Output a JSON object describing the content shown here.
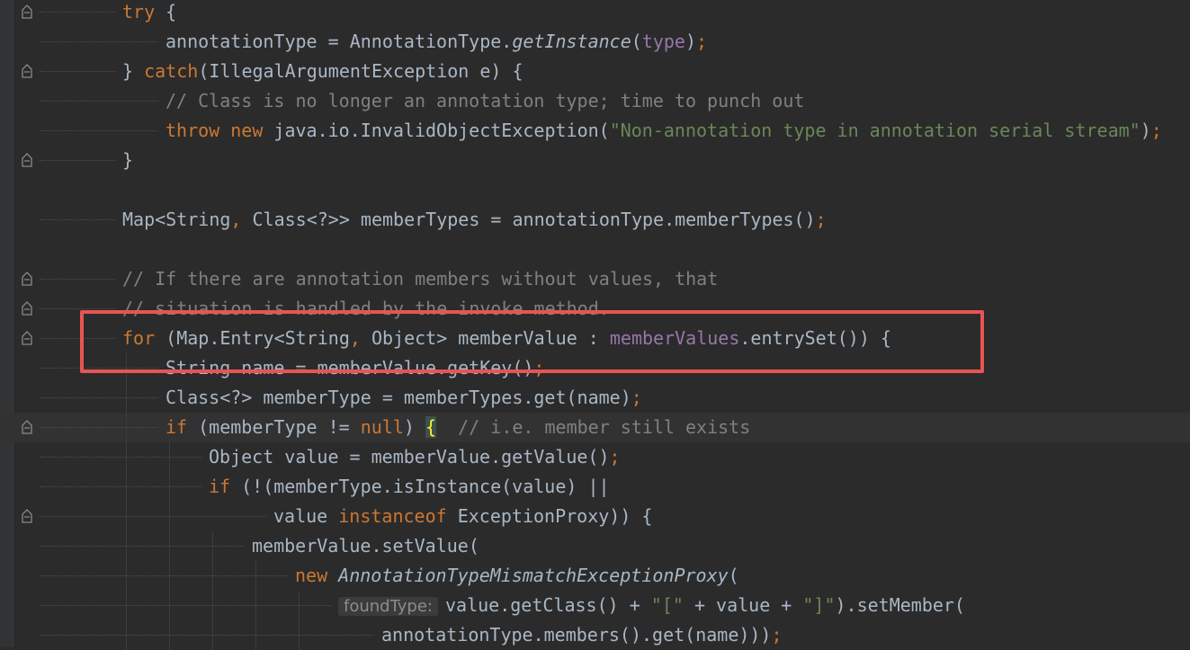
{
  "editor": {
    "lines": [
      {
        "indent": 0,
        "fold": true,
        "tokens": [
          {
            "t": "try",
            "c": "kw"
          },
          {
            "t": " {"
          }
        ]
      },
      {
        "indent": 1,
        "fold": false,
        "tokens": [
          {
            "t": "annotationType = AnnotationType."
          },
          {
            "t": "getInstance",
            "c": "it"
          },
          {
            "t": "("
          },
          {
            "t": "type",
            "c": "field"
          },
          {
            "t": ")"
          },
          {
            "t": ";",
            "c": "kw"
          }
        ]
      },
      {
        "indent": 0,
        "fold": true,
        "tokens": [
          {
            "t": "} "
          },
          {
            "t": "catch",
            "c": "kw"
          },
          {
            "t": "(IllegalArgumentException e) {"
          }
        ]
      },
      {
        "indent": 1,
        "fold": false,
        "tokens": [
          {
            "t": "// Class is no longer an annotation type; time to punch out",
            "c": "cmt"
          }
        ]
      },
      {
        "indent": 1,
        "fold": false,
        "tokens": [
          {
            "t": "throw new",
            "c": "kw"
          },
          {
            "t": " java.io.InvalidObjectException("
          },
          {
            "t": "\"Non-annotation type in annotation serial stream\"",
            "c": "str"
          },
          {
            "t": ")"
          },
          {
            "t": ";",
            "c": "kw"
          }
        ]
      },
      {
        "indent": 0,
        "fold": true,
        "tokens": [
          {
            "t": "}"
          }
        ]
      },
      {
        "indent": 0,
        "fold": false,
        "tokens": []
      },
      {
        "indent": 0,
        "fold": false,
        "tokens": [
          {
            "t": "Map<String"
          },
          {
            "t": ",",
            "c": "kw"
          },
          {
            "t": " Class<?>> memberTypes = annotationType.memberTypes()"
          },
          {
            "t": ";",
            "c": "kw"
          }
        ]
      },
      {
        "indent": 0,
        "fold": false,
        "tokens": []
      },
      {
        "indent": 0,
        "fold": true,
        "tokens": [
          {
            "t": "// If there are annotation members without values, that",
            "c": "cmt"
          }
        ]
      },
      {
        "indent": 0,
        "fold": true,
        "tokens": [
          {
            "t": "// situation is handled by the invoke method.",
            "c": "cmt"
          }
        ]
      },
      {
        "indent": 0,
        "fold": true,
        "tokens": [
          {
            "t": "for",
            "c": "kw"
          },
          {
            "t": " (Map.Entry<String"
          },
          {
            "t": ",",
            "c": "kw"
          },
          {
            "t": " Object> memberValue : "
          },
          {
            "t": "memberValues",
            "c": "field"
          },
          {
            "t": ".entrySet()) {"
          }
        ]
      },
      {
        "indent": 1,
        "fold": false,
        "tokens": [
          {
            "t": "String name = memberValue.getKey()"
          },
          {
            "t": ";",
            "c": "kw"
          }
        ]
      },
      {
        "indent": 1,
        "fold": false,
        "tokens": [
          {
            "t": "Class<?> memberType = memberTypes.get(name)"
          },
          {
            "t": ";",
            "c": "kw"
          }
        ]
      },
      {
        "indent": 1,
        "fold": true,
        "current": true,
        "tokens": [
          {
            "t": "if",
            "c": "kw"
          },
          {
            "t": " (memberType != "
          },
          {
            "t": "null",
            "c": "kw"
          },
          {
            "t": ") "
          },
          {
            "t": "{",
            "c": "brace"
          },
          {
            "t": "  "
          },
          {
            "t": "// i.e. member still exists",
            "c": "cmt"
          }
        ]
      },
      {
        "indent": 2,
        "fold": false,
        "tokens": [
          {
            "t": "Object value = memberValue.getValue()"
          },
          {
            "t": ";",
            "c": "kw"
          }
        ]
      },
      {
        "indent": 2,
        "fold": false,
        "tokens": [
          {
            "t": "if",
            "c": "kw"
          },
          {
            "t": " (!(memberType.isInstance(value) ||"
          }
        ]
      },
      {
        "indent": 3.5,
        "fold": true,
        "tokens": [
          {
            "t": "value "
          },
          {
            "t": "instanceof",
            "c": "kw"
          },
          {
            "t": " ExceptionProxy)) {"
          }
        ]
      },
      {
        "indent": 3,
        "fold": false,
        "tokens": [
          {
            "t": "memberValue.setValue("
          }
        ]
      },
      {
        "indent": 4,
        "fold": false,
        "tokens": [
          {
            "t": "new",
            "c": "kw"
          },
          {
            "t": " "
          },
          {
            "t": "AnnotationTypeMismatchExceptionProxy",
            "c": "it"
          },
          {
            "t": "("
          }
        ]
      },
      {
        "indent": 5,
        "fold": false,
        "tokens": [
          {
            "t": "foundType:",
            "c": "hint"
          },
          {
            "t": "value.getClass() + "
          },
          {
            "t": "\"[\"",
            "c": "str"
          },
          {
            "t": " + value + "
          },
          {
            "t": "\"]\"",
            "c": "str"
          },
          {
            "t": ").setMember("
          }
        ]
      },
      {
        "indent": 6,
        "fold": false,
        "tokens": [
          {
            "t": "annotationType.members().get(name)))"
          },
          {
            "t": ";",
            "c": "kw"
          }
        ]
      }
    ]
  },
  "highlight": {
    "color": "#e85454"
  }
}
